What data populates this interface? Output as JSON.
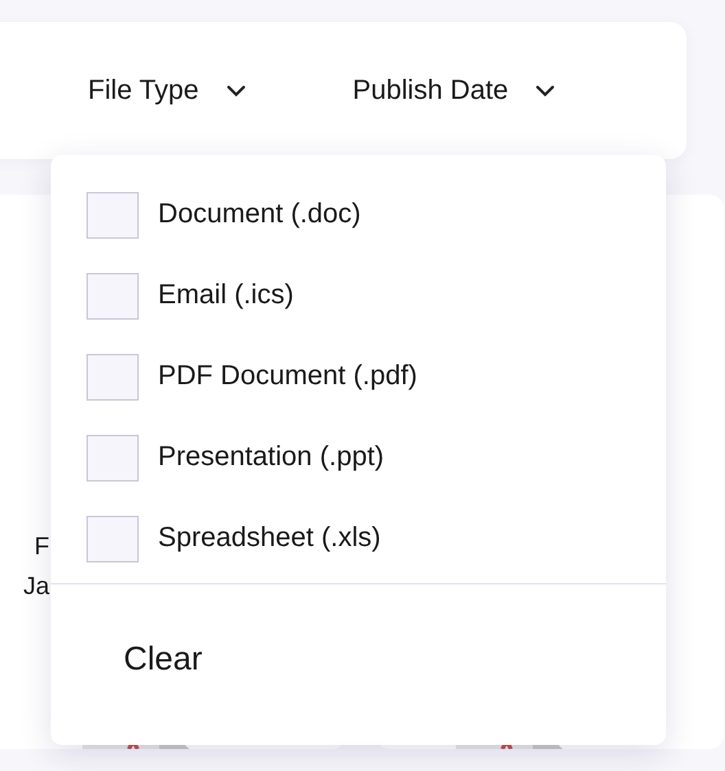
{
  "filters": [
    {
      "label": "File Type"
    },
    {
      "label": "Publish Date"
    }
  ],
  "dropdown": {
    "options": [
      {
        "label": "Document (.doc)",
        "checked": false
      },
      {
        "label": "Email (.ics)",
        "checked": false
      },
      {
        "label": "PDF Document (.pdf)",
        "checked": false
      },
      {
        "label": "Presentation (.ppt)",
        "checked": false
      },
      {
        "label": "Spreadsheet (.xls)",
        "checked": false
      }
    ],
    "clear": "Clear"
  },
  "card_lines": [
    "F",
    "Ja"
  ]
}
